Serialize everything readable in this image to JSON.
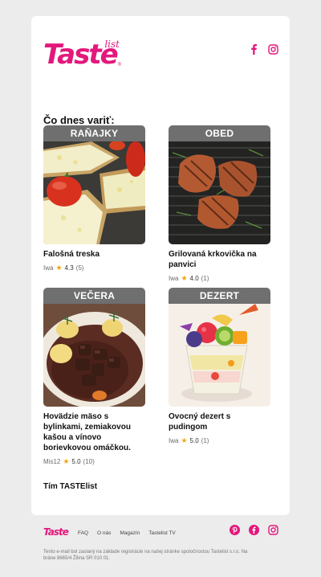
{
  "header": {
    "logo_main": "Taste",
    "logo_sub": "list",
    "logo_reg": "®",
    "social": [
      "facebook-icon",
      "instagram-icon"
    ]
  },
  "main": {
    "heading": "Čo dnes variť:",
    "recipes": [
      {
        "tag": "RAŇAJKY",
        "title": "Falošná treska",
        "author": "Iwa",
        "rating": "4.3",
        "count": "(5)"
      },
      {
        "tag": "OBED",
        "title": "Grilovaná krkovička na panvici",
        "author": "Iwa",
        "rating": "4.0",
        "count": "(1)"
      },
      {
        "tag": "VEČERA",
        "title": "Hovädzie mäso s bylinkami, zemiakovou kašou a vínovo borievkovou omáčkou.",
        "author": "Mis12",
        "rating": "5.0",
        "count": "(10)"
      },
      {
        "tag": "DEZERT",
        "title": "Ovocný dezert s pudingom",
        "author": "Iwa",
        "rating": "5.0",
        "count": "(1)"
      }
    ],
    "signature": "Tím TASTElist"
  },
  "footer": {
    "logo": "Taste",
    "nav": [
      "FAQ",
      "O nás",
      "Magazín",
      "Tastelist TV"
    ],
    "social": [
      "pinterest-icon",
      "facebook-icon",
      "instagram-icon"
    ],
    "disclaimer": "Tento e-mail bol zaslaný na základe registrácie na našej stránke spoločnostou Tastelist s.r.o. Na bráne 8665/4 Žilina SR 010 01."
  },
  "colors": {
    "brand": "#e3187c",
    "tag_bg": "#6f6f6f",
    "star": "#f2a50f",
    "page_bg": "#ececec"
  }
}
